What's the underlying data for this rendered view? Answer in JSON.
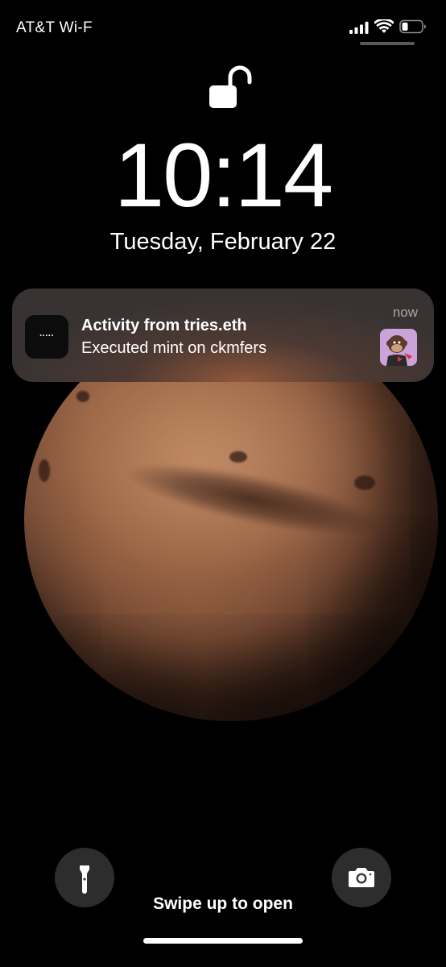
{
  "status_bar": {
    "carrier": "AT&T Wi-F",
    "icons": [
      "signal-icon",
      "wifi-icon",
      "battery-icon"
    ]
  },
  "lock_screen": {
    "lock_state_icon": "unlocked-padlock-icon",
    "time": "10:14",
    "date": "Tuesday, February 22"
  },
  "notification": {
    "app_icon": "app-icon",
    "app_icon_text": ".....",
    "title": "Activity from tries.eth",
    "body": "Executed mint on ckmfers",
    "time": "now",
    "thumbnail": "cartoon-monkey-nft-thumbnail"
  },
  "bottom": {
    "flashlight_icon": "flashlight-icon",
    "camera_icon": "camera-icon",
    "swipe_hint": "Swipe up to open"
  },
  "colors": {
    "background": "#000000",
    "planet": "#9c6646",
    "notification_bg": "#3a3533",
    "thumb_bg": "#c9a3d9"
  }
}
